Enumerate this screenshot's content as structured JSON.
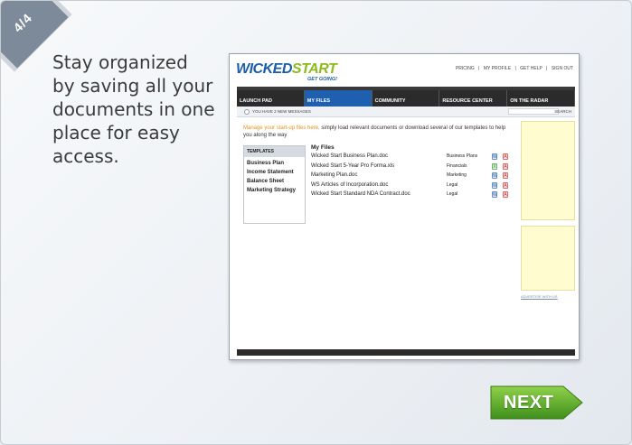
{
  "step_indicator": "4/4",
  "headline": "Stay organized by saving all your documents in one place for easy access.",
  "app": {
    "logo_part1": "WICKED",
    "logo_part2": "START",
    "tagline": "GET GOING!",
    "top_links": [
      "PRICING",
      "|",
      "MY PROFILE",
      "|",
      "GET HELP",
      "|",
      "SIGN OUT"
    ],
    "nav": [
      "LAUNCH PAD",
      "MY FILES",
      "COMMUNITY",
      "RESOURCE CENTER",
      "ON THE RADAR"
    ],
    "active_nav": "MY FILES",
    "messages": "YOU HAVE 2 NEW MESSAGES",
    "search_label": "SEARCH",
    "intro_highlight": "Manage your start-up files here,",
    "intro_rest": " simply load relevant documents or download several of our templates to help you along the way",
    "templates_header": "TEMPLATES",
    "templates": [
      "Business Plan",
      "Income Statement",
      "Balance Sheet",
      "Marketing Strategy"
    ],
    "files_title": "My Files",
    "files": [
      {
        "name": "Wicked Start Business Plan.doc",
        "category": "Business Plans",
        "type": "doc"
      },
      {
        "name": "Wicked Start 5-Year Pro Forma.xls",
        "category": "Financials",
        "type": "xls"
      },
      {
        "name": "Marketing Plan.doc",
        "category": "Marketing",
        "type": "doc"
      },
      {
        "name": "WS Articles of Incorporation.doc",
        "category": "Legal",
        "type": "doc"
      },
      {
        "name": "Wicked Start Standard NDA Contract.doc",
        "category": "Legal",
        "type": "doc"
      }
    ],
    "advertise": "ADVERTISE WITH US"
  },
  "next_button": "NEXT",
  "colors": {
    "brand_blue": "#1b5ea8",
    "brand_green": "#8dbb1e",
    "next_green": "#5fae2a",
    "highlight_orange": "#e8901a"
  }
}
